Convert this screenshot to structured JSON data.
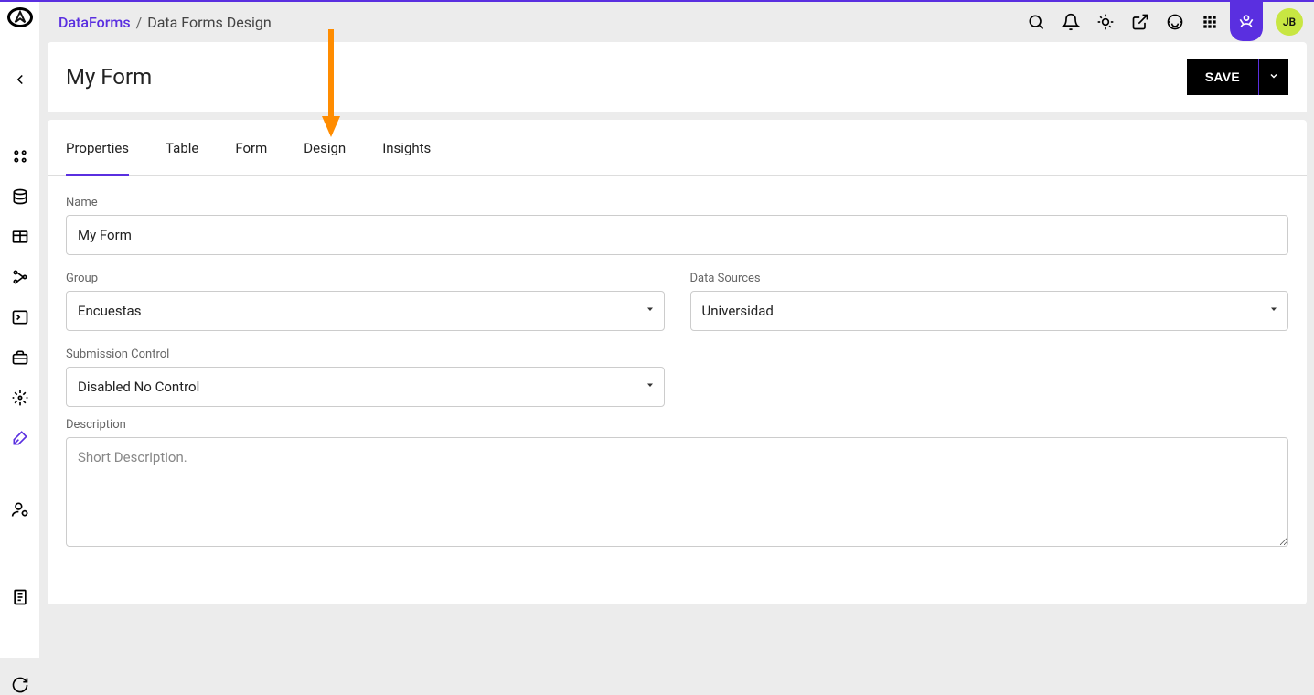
{
  "breadcrumb": {
    "root": "DataForms",
    "sep": "/",
    "leaf": "Data Forms Design"
  },
  "page": {
    "title": "My Form",
    "save_label": "SAVE"
  },
  "avatar": {
    "initials": "JB"
  },
  "tabs": {
    "properties": "Properties",
    "table": "Table",
    "form": "Form",
    "design": "Design",
    "insights": "Insights"
  },
  "form": {
    "name_label": "Name",
    "name_value": "My Form",
    "group_label": "Group",
    "group_value": "Encuestas",
    "data_sources_label": "Data Sources",
    "data_sources_value": "Universidad",
    "submission_label": "Submission Control",
    "submission_value": "Disabled No Control",
    "description_label": "Description",
    "description_placeholder": "Short Description."
  }
}
